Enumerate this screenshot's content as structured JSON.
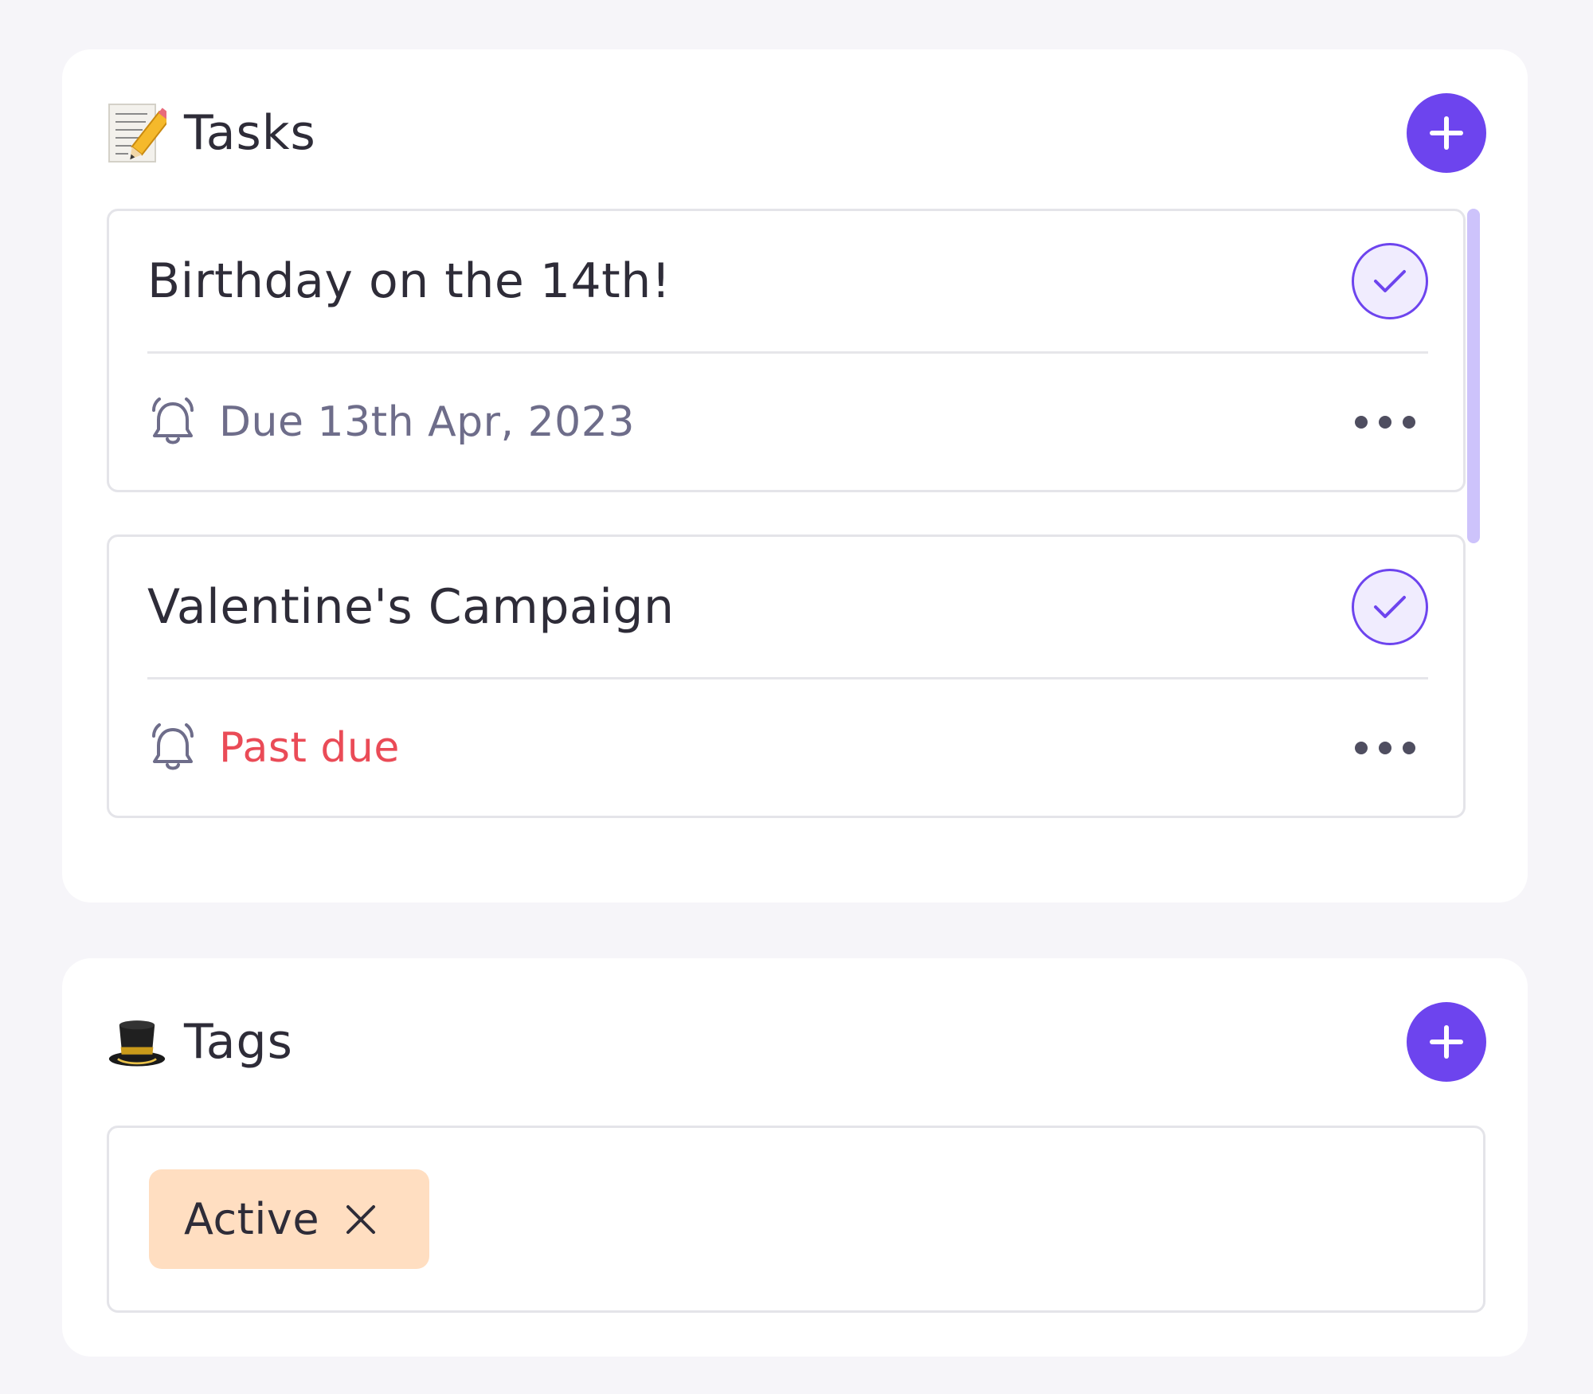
{
  "tasks_section": {
    "title": "Tasks",
    "title_icon": "memo-pencil-icon",
    "add_icon": "plus-icon",
    "items": [
      {
        "title": "Birthday on the 14th!",
        "due": "Due 13th Apr, 2023",
        "status": "due"
      },
      {
        "title": "Valentine's Campaign",
        "due": "Past due",
        "status": "past-due"
      }
    ]
  },
  "tags_section": {
    "title": "Tags",
    "title_icon": "top-hat-icon",
    "add_icon": "plus-icon",
    "tags": [
      {
        "label": "Active",
        "color": "#ffdec1"
      }
    ]
  },
  "colors": {
    "accent": "#6d44ee",
    "past_due": "#ea4b57",
    "due": "#6e6d8a",
    "scrollbar": "#cdc3fb"
  }
}
